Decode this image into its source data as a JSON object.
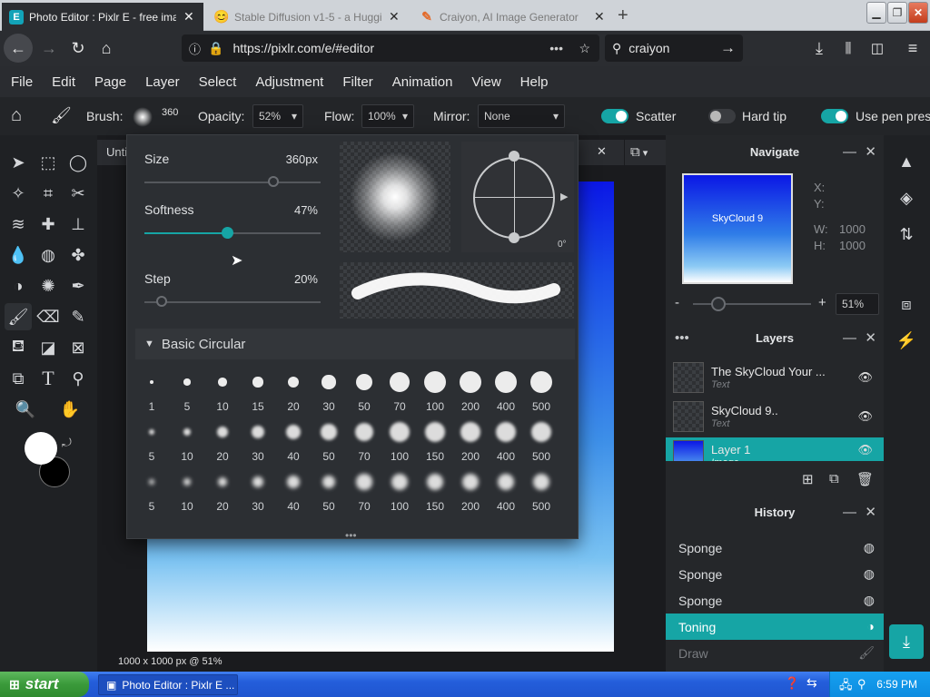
{
  "browser": {
    "tabs": [
      {
        "label": "Photo Editor : Pixlr E - free image"
      },
      {
        "label": "Stable Diffusion v1-5 - a Hugging"
      },
      {
        "label": "Craiyon, AI Image Generator"
      }
    ],
    "url": "https://pixlr.com/e/#editor",
    "search_value": "craiyon"
  },
  "menu": [
    "File",
    "Edit",
    "Page",
    "Layer",
    "Select",
    "Adjustment",
    "Filter",
    "Animation",
    "View",
    "Help"
  ],
  "options": {
    "brush_label": "Brush:",
    "brush_size": "360",
    "opacity_label": "Opacity:",
    "opacity_value": "52%",
    "flow_label": "Flow:",
    "flow_value": "100%",
    "mirror_label": "Mirror:",
    "mirror_value": "None",
    "scatter_label": "Scatter",
    "scatter_on": true,
    "hardtip_label": "Hard tip",
    "hardtip_on": false,
    "pen_label": "Use pen pres",
    "pen_on": true
  },
  "doc": {
    "tab_label": "Unti",
    "status": "1000 x 1000 px @ 51%"
  },
  "brush_popup": {
    "size_label": "Size",
    "size_value": "360px",
    "size_level": 0.73,
    "softness_label": "Softness",
    "softness_value": "47%",
    "softness_level": 0.47,
    "step_label": "Step",
    "step_value": "20%",
    "step_level": 0.1,
    "angle_label": "0°",
    "preset_title": "Basic Circular",
    "preset_rows": [
      {
        "style": "hard",
        "sizes": [
          "1",
          "5",
          "10",
          "15",
          "20",
          "30",
          "50",
          "70",
          "100",
          "200",
          "400",
          "500"
        ]
      },
      {
        "style": "soft",
        "sizes": [
          "5",
          "10",
          "20",
          "30",
          "40",
          "50",
          "70",
          "100",
          "150",
          "200",
          "400",
          "500"
        ]
      },
      {
        "style": "softer",
        "sizes": [
          "5",
          "10",
          "20",
          "30",
          "40",
          "50",
          "70",
          "100",
          "150",
          "200",
          "400",
          "500"
        ]
      }
    ]
  },
  "navigate": {
    "title": "Navigate",
    "preview_text": "SkyCloud 9",
    "x_label": "X:",
    "y_label": "Y:",
    "w_label": "W:",
    "w_value": "1000",
    "h_label": "H:",
    "h_value": "1000",
    "minus": "-",
    "plus": "+",
    "zoom": "51%"
  },
  "layers": {
    "title": "Layers",
    "items": [
      {
        "name": "The SkyCloud Your ...",
        "type": "Text"
      },
      {
        "name": "SkyCloud 9..",
        "type": "Text"
      },
      {
        "name": "Layer 1",
        "type": "Image"
      }
    ]
  },
  "history": {
    "title": "History",
    "items": [
      {
        "label": "Sponge"
      },
      {
        "label": "Sponge"
      },
      {
        "label": "Sponge"
      },
      {
        "label": "Toning"
      },
      {
        "label": "Draw"
      }
    ]
  },
  "taskbar": {
    "start": "start",
    "item": "Photo Editor : Pixlr E ...",
    "time": "6:59 PM"
  },
  "colors": {
    "accent": "#16a5a5",
    "foreground": "#ffffff",
    "background": "#000000"
  }
}
